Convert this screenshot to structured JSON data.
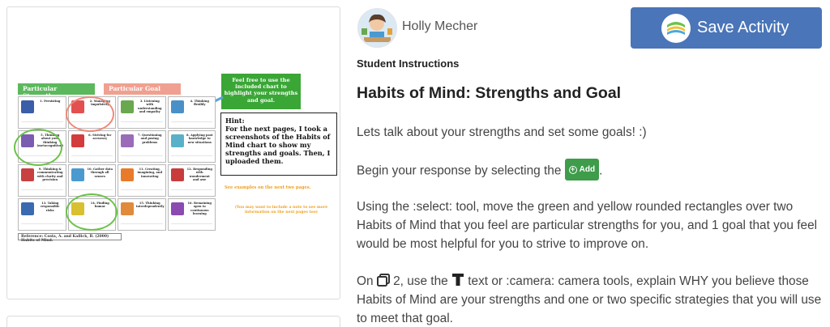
{
  "author": {
    "name": "Holly Mecher"
  },
  "actions": {
    "save_label": "Save Activity"
  },
  "instructions": {
    "section_label": "Student Instructions",
    "title": "Habits of Mind: Strengths and Goal",
    "p1": "Lets talk about your strengths and set some goals! :)",
    "p2_before": "Begin your response by selecting the",
    "add_label": "Add",
    "p2_after": ".",
    "p3": "Using the :select: tool, move the green and yellow rounded rectangles over two Habits of Mind that you feel are particular strengths for you, and 1 goal that you feel would be most helpful for you to strive to improve on.",
    "p4_on": "On",
    "p4_page": "2, use the",
    "p4_rest": "text or :camera: camera tools, explain WHY you believe those Habits of Mind are your strengths and one or two specific strategies that you will use to meet that goal."
  },
  "preview": {
    "legend_strengths": "Particular Strengths",
    "legend_goal": "Particular Goal",
    "feel_free": "Feel free to use the included chart to highlight your strengths and goal.",
    "hint": "Hint:\nFor the next pages, I took a screenshots of the Habits of Mind chart to show my strengths and goals. Then, I uploaded them.",
    "examples": "See examples on the next two pages.",
    "examples_note": "(You may want to include a note to see more information on the next pages too)",
    "reference": "Reference: Costa, A. and Kallick, B. (2000) Habits of Mind.",
    "cells": [
      {
        "t": "1. Persisting",
        "c": "#3a5ea8"
      },
      {
        "t": "2. Managing impulsivity",
        "c": "#e35050"
      },
      {
        "t": "3. Listening with understanding and empathy",
        "c": "#6aa84f"
      },
      {
        "t": "4. Thinking flexibly",
        "c": "#4a90c8"
      },
      {
        "t": "5. Thinking about your thinking (metacognition)",
        "c": "#7a5cb0"
      },
      {
        "t": "6. Striving for accuracy",
        "c": "#d23c3c"
      },
      {
        "t": "7. Questioning and posing problems",
        "c": "#9a6bb8"
      },
      {
        "t": "8. Applying past knowledge to new situations",
        "c": "#5ab0c8"
      },
      {
        "t": "9. Thinking & communicating with clarity and precision",
        "c": "#c84040"
      },
      {
        "t": "10. Gather data through all senses",
        "c": "#4a9ad0"
      },
      {
        "t": "11. Creating, imagining, and innovating",
        "c": "#e87a2a"
      },
      {
        "t": "12. Responding with wonderment and awe",
        "c": "#c83c3c"
      },
      {
        "t": "13. Taking responsible risks",
        "c": "#3a6ab0"
      },
      {
        "t": "14. Finding humor",
        "c": "#d8c030"
      },
      {
        "t": "15. Thinking interdependently",
        "c": "#e08a3a"
      },
      {
        "t": "16. Remaining open to continuous learning",
        "c": "#8a4ab0"
      }
    ]
  }
}
